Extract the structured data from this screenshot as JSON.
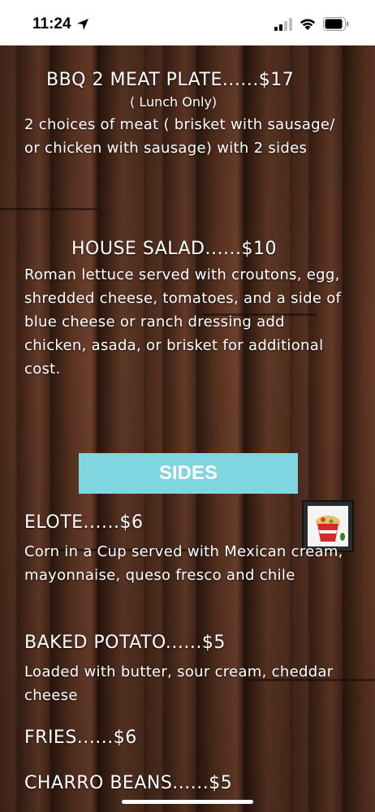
{
  "status_bar": {
    "time": "11:24"
  },
  "menu": {
    "items": [
      {
        "title": "BBQ 2 MEAT PLATE......$17",
        "subtitle": "( Lunch Only)",
        "description": "2 choices of meat ( brisket with sausage/ or chicken with sausage) with 2 sides"
      },
      {
        "title": "HOUSE SALAD......$10",
        "description": "Roman lettuce served with croutons, egg, shredded cheese, tomatoes, and a side of blue cheese or ranch dressing add chicken, asada, or brisket for additional cost."
      }
    ],
    "sides_heading": "SIDES",
    "sides": [
      {
        "title": "ELOTE......$6",
        "description": "Corn in a Cup served with Mexican cream, mayonnaise, queso fresco and chile"
      },
      {
        "title": "BAKED POTATO......$5",
        "description": "Loaded with butter, sour cream, cheddar cheese"
      },
      {
        "title": "FRIES......$6"
      },
      {
        "title": "CHARRO BEANS......$5"
      }
    ]
  },
  "colors": {
    "sides_bar": "#7fd5e0",
    "menu_text": "#ffffff"
  },
  "icons": [
    "location-arrow-icon",
    "cellular-signal-icon",
    "wifi-icon",
    "battery-icon",
    "elote-thumbnail"
  ]
}
